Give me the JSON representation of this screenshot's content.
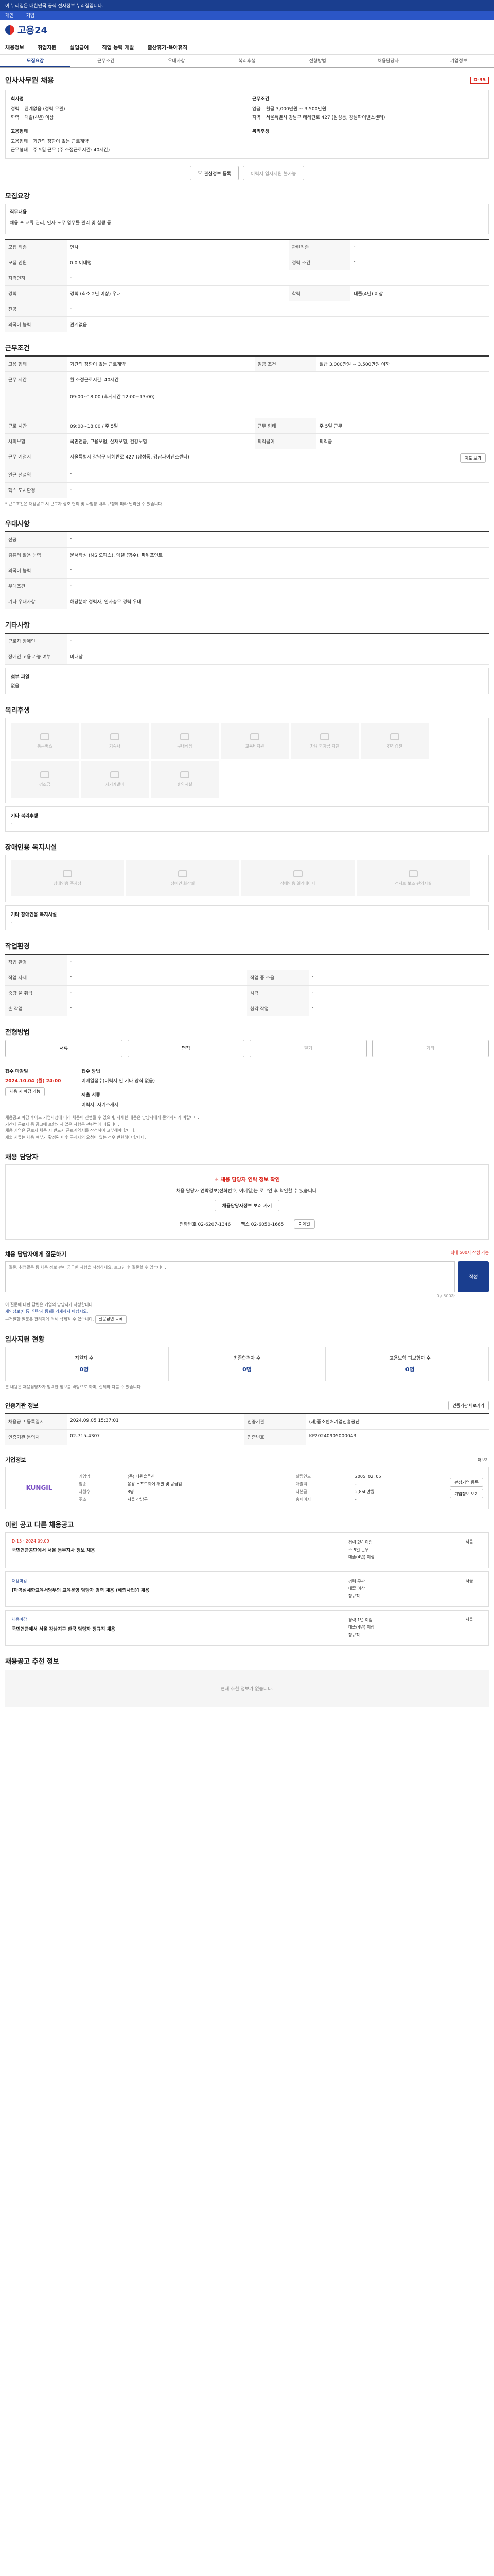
{
  "topbar": {
    "notice": "이 누리집은 대한민국 공식 전자정부 누리집입니다."
  },
  "topbar2": {
    "items": [
      "개인",
      "기업"
    ]
  },
  "header": {
    "logo_text": "고용24"
  },
  "gnb": [
    "채용정보",
    "취업지원",
    "실업급여",
    "직업 능력 개발",
    "출산휴가·육아휴직"
  ],
  "subtabs": [
    "모집요강",
    "근무조건",
    "우대사항",
    "복리후생",
    "전형방법",
    "채용담당자",
    "기업정보"
  ],
  "job": {
    "title": "인사사무원 채용",
    "badge": "D-35",
    "company_label": "회사명",
    "company_value": "",
    "career_label": "경력",
    "career_value": "관계없음 (경력 무관)",
    "edu_label": "학력",
    "edu_value": "대졸(4년) 이상",
    "cond_label": "근무조건",
    "pay_label": "임금",
    "pay_value": "월급 3,000만원 ~ 3,500만원",
    "region_label": "지역",
    "region_value": "서울특별시 강남구 테헤란로 427 (삼성동, 강남파이낸스센터)",
    "type_label": "고용형태",
    "type_value": "기간의 정함이 없는 근로계약",
    "hours_label": "근무형태",
    "hours_value": "주 5일 근무 (주 소정근로시간: 40시간)",
    "welfare_label": "복리후생",
    "btn_interest": "관심정보 등록",
    "btn_apply": "이력서 입사지원 불가능"
  },
  "recruit": {
    "title": "모집요강",
    "duty_label": "직무내용",
    "duty_value": "채용 포 교류 관리, 인사 노무 업무를 관리 및 실행 등",
    "rows": [
      {
        "l": "모집 직종",
        "v": "인사",
        "l2": "관련직종",
        "v2": "-"
      },
      {
        "l": "모집 인원",
        "v": "0.0 이내명",
        "l2": "경력 조건",
        "v2": "-"
      },
      {
        "l": "자격면허",
        "v": "-"
      },
      {
        "l": "경력",
        "v": "경력 (최소 2년 이상) 우대",
        "l2": "학력",
        "v2": "대졸(4년) 이상"
      },
      {
        "l": "전공",
        "v": "-"
      },
      {
        "l": "외국어 능력",
        "v": "관계없음"
      }
    ]
  },
  "work": {
    "title": "근무조건",
    "rows": [
      {
        "l": "고용 형태",
        "v": "기간의 정함이 없는 근로계약",
        "l2": "임금 조건",
        "v2": "월급 3,000만원 ~ 3,500만원 이하"
      },
      {
        "l": "근무 시간",
        "v": "월 소정근로시간: 40시간"
      },
      {
        "l": "근무 시간 상세",
        "v": "09:00~18:00 (휴게시간 12:00~13:00)"
      },
      {
        "l": "근로 시간",
        "v": "09:00~18:00 / 주 5일",
        "l2": "근무 형태",
        "v2": "주 5일 근무"
      },
      {
        "l": "사회보험",
        "v": "국민연금, 고용보험, 산재보험, 건강보험",
        "l2": "퇴직급여",
        "v2": "퇴직금"
      },
      {
        "l": "근무 예정지",
        "v": "서울특별시 강남구 테헤란로 427 (삼성동, 강남파이낸스센터)"
      },
      {
        "l": "인근 전철역",
        "v": "-"
      },
      {
        "l": "핵스 도시환경",
        "v": "-"
      }
    ],
    "map_button": "지도 보기",
    "note": "* 근로조건은 채용공고 시 근로자 상호 협의 및 사업장 내부 규정에 따라 달라질 수 있습니다."
  },
  "prefer": {
    "title": "우대사항",
    "rows": [
      {
        "l": "전공",
        "v": "-"
      },
      {
        "l": "컴퓨터 활용 능력",
        "v": "문서작성 (MS 오피스), 엑셀 (함수), 파워포인트"
      },
      {
        "l": "외국어 능력",
        "v": "-"
      },
      {
        "l": "우대조건",
        "v": "-"
      },
      {
        "l": "기타 우대사항",
        "v": "해당분야 경력자, 인사총무 경력 우대"
      }
    ]
  },
  "etc": {
    "title": "기타사항",
    "rows": [
      {
        "l": "근로자 장애인",
        "v": "-"
      },
      {
        "l": "장애인 고용 가능 여부",
        "v": "비대상"
      }
    ],
    "pdf_label": "첨부 파일",
    "pdf_value": "없음"
  },
  "welfare": {
    "title": "복리후생",
    "items": [
      "통근버스",
      "기숙사",
      "구내식당",
      "교육비지원",
      "자녀 학자금 지원",
      "건강검진",
      "경조금",
      "자기계발비",
      "휴양시설"
    ],
    "other_label": "기타 복리후생",
    "other_value": "-"
  },
  "facility": {
    "title": "장애인용 복지시설",
    "items": [
      "장애인용 주차장",
      "장애인 화장실",
      "장애인용 엘리베이터",
      "경사로 보조 편의시설"
    ],
    "other_label": "기타 장애인용 복지시설",
    "other_value": "-"
  },
  "process": {
    "title": "작업환경",
    "rows": [
      {
        "l": "작업 환경",
        "v": "-"
      },
      {
        "l": "작업 자세",
        "v": "-",
        "l2": "작업 중 소음",
        "v2": "-"
      },
      {
        "l": "중량 물 취급",
        "v": "-",
        "l2": "시력",
        "v2": "-"
      },
      {
        "l": "손 작업",
        "v": "-",
        "l2": "청각 작업",
        "v2": "-"
      }
    ]
  },
  "method": {
    "title": "전형방법",
    "steps": [
      "서류",
      "면접",
      "필기",
      "기타"
    ],
    "deadline_label": "접수 마감일",
    "deadline_value": "2024.10.04 (월) 24:00",
    "deadline_btn": "채용 시 마감 가능",
    "apply_label": "접수 방법",
    "apply_value": "이메일접수(이력서 인 기타 양식 없음)",
    "doc_label": "제출 서류",
    "doc_value": "이력서, 자기소개서",
    "notices": [
      "채용공고 마감 후에도 기업사정에 따라 채용이 진행될 수 있으며, 자세한 내용은 담당자에게 문의하시기 바랍니다.",
      "기간제 근로자 등 공고에 포함되지 않은 사항은 관련법에 따릅니다.",
      "채용 기업은 근로자 채용 시 반드시 근로계약서를 작성하여 교부해야 합니다.",
      "제출 서류는 채용 여부가 확정된 이후 구직자의 요청이 있는 경우 반환해야 합니다."
    ]
  },
  "contact": {
    "title": "채용 담당자",
    "alert_title": "채용 담당자 연락 정보 확인",
    "alert_text": "채용 담당자 연락정보(전화번호, 이메일)는 로그인 후 확인할 수 있습니다.",
    "alert_btn": "채용담당자정보 보러 가기",
    "phone": "전화번호 02-6207-1346",
    "fax": "팩스 02-6050-1665",
    "email_btn": "이메일"
  },
  "inquiry": {
    "title": "채용 담당자에게 질문하기",
    "hint": "최대 500자 작성 가능",
    "placeholder": "질문, 취업활동 등 채용 정보 관련 궁금한 사항을 작성하세요. 로그인 후 질문할 수 있습니다.",
    "submit": "작성",
    "counter": "0 / 500자",
    "notes": [
      "이 질문에 대한 답변은 기업의 담당자가 작성합니다.",
      "개인정보(이름, 연락처 등)를 기재하지 마십시오.",
      "부적절한 질문은 관리자에 의해 삭제될 수 있습니다."
    ],
    "notes_btn": "질문답변 목록"
  },
  "applicants": {
    "title": "입사지원 현황",
    "items": [
      {
        "label": "지원자 수",
        "value": "0명"
      },
      {
        "label": "최종합격자 수",
        "value": "0명"
      },
      {
        "label": "고용보험 피보험자 수",
        "value": "0명"
      }
    ],
    "note": "본 내용은 채용담당자가 입력한 정보를 바탕으로 하며, 실제와 다를 수 있습니다."
  },
  "auth": {
    "title": "인증기관 정보",
    "btn": "인증기관 바로가기",
    "rows": [
      {
        "l": "채용공고 등록일시",
        "v": "2024.09.05 15:37:01",
        "l2": "인증기관",
        "v2": "(재)중소벤처기업진흥공단"
      },
      {
        "l": "인증기관 문의처",
        "v": "02-715-4307",
        "l2": "인증번호",
        "v2": "KP20240905000043"
      }
    ]
  },
  "company": {
    "title": "기업정보",
    "more": "더보기",
    "logo_text": "KUNGIL",
    "rows": [
      {
        "l": "기업명",
        "v": "(주) 다원솔루션",
        "l2": "설립연도",
        "v2": "2005. 02. 05"
      },
      {
        "l": "업종",
        "v": "응용 소프트웨어 개발 및 공급업",
        "l2": "매출액",
        "v2": "-"
      },
      {
        "l": "사원수",
        "v": "8명",
        "l2": "자본금",
        "v2": "2,860만원"
      },
      {
        "l": "주소",
        "v": "서울 강남구",
        "l2": "홈페이지",
        "v2": "-"
      }
    ],
    "btn1": "관심기업 등록",
    "btn2": "기업정보 보기"
  },
  "similar": {
    "title": "이런 공고 다른 채용공고",
    "items": [
      {
        "date": "D-15 · 2024.09.09",
        "title": "국민연금공단에서 서울 동부지사 정보 채용",
        "tags": [
          "경력 2년 이상",
          "주 5일 근무",
          "대졸(4년) 이상"
        ],
        "badge": "서울"
      },
      {
        "date": "채용마감",
        "title": "[마곡섬세한교육서당부의 교육운영 담당자 경력 채용 (해외사업)] 채용",
        "tags": [
          "경력 무관",
          "대졸 이상",
          "정규직"
        ],
        "badge": "서울"
      },
      {
        "date": "채용마감",
        "title": "국민연금에서 서울 강남지구 한국 담당자 정규직 채용",
        "tags": [
          "경력 1년 이상",
          "대졸(4년) 이상",
          "정규직"
        ],
        "badge": "서울"
      }
    ]
  },
  "recommend": {
    "title": "채용공고 추천 정보",
    "empty": "현재 추천 정보가 없습니다."
  }
}
